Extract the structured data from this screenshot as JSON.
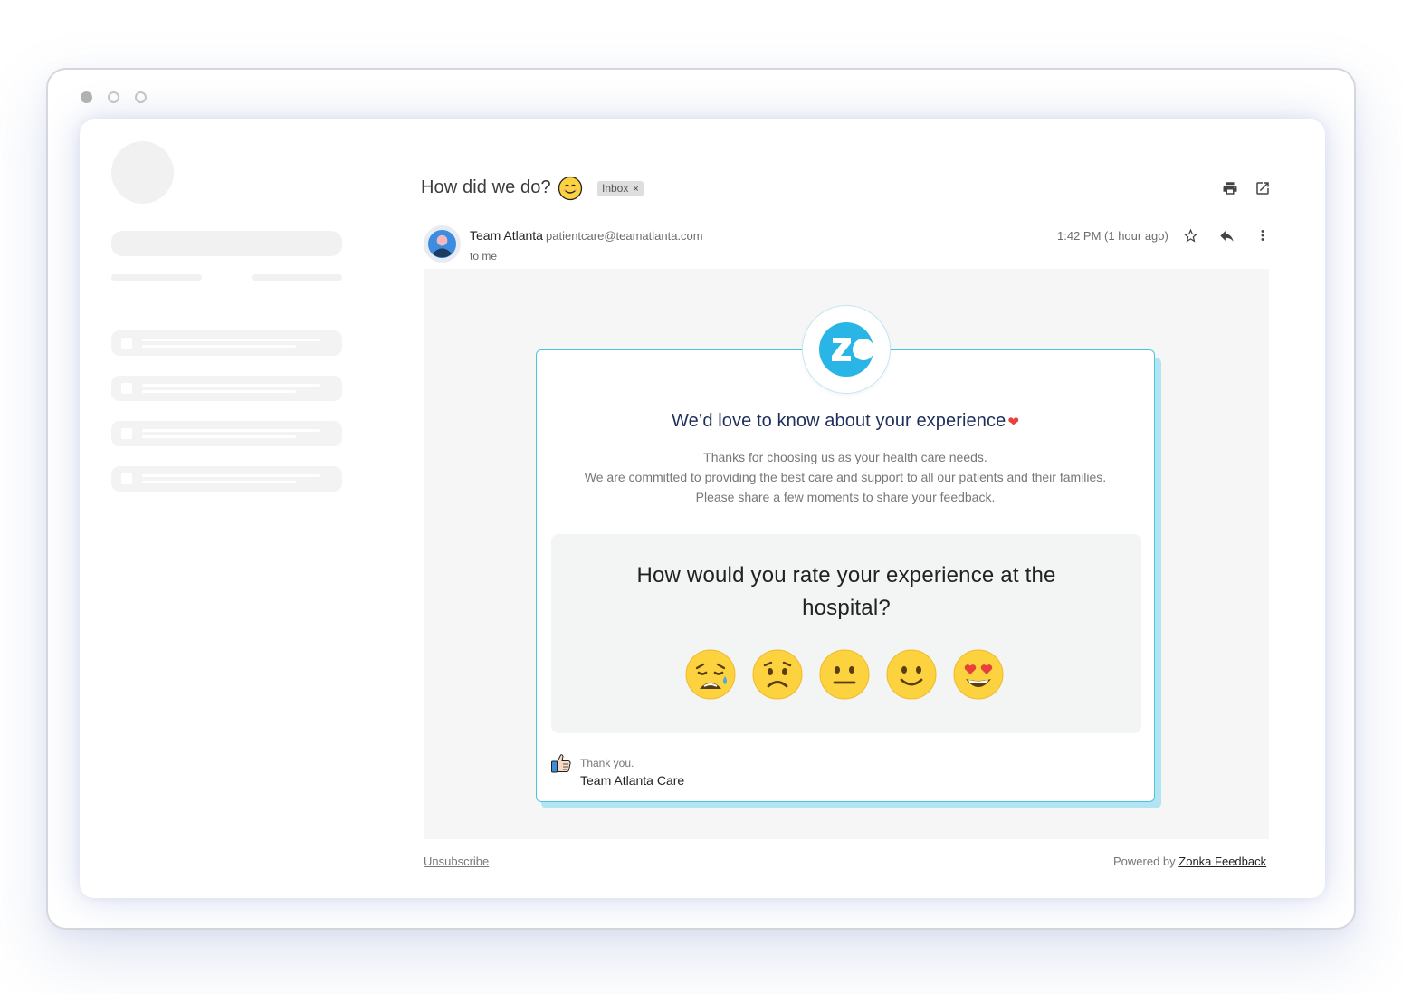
{
  "email": {
    "subject": "How did we do?",
    "label_chip": "Inbox",
    "label_remove": "×",
    "sender_name": "Team Atlanta",
    "sender_email": "patientcare@teamatlanta.com",
    "recipient": "to me",
    "time": "1:42 PM (1 hour ago)"
  },
  "icons": {
    "subject_emoji": "smiling-face-icon",
    "print": "print-icon",
    "open_new_window": "open-in-new-icon",
    "star": "star-icon",
    "reply": "reply-icon",
    "more": "more-vert-icon",
    "avatar": "person-avatar-icon",
    "logo": "zonka-logo-icon",
    "thumbs": "thumbs-up-icon"
  },
  "survey": {
    "title": "We’d love to know about your experience",
    "heart": "❤",
    "description": [
      "Thanks for choosing us as your health care needs.",
      "We are committed to providing the best care and support to all our patients and their families.",
      "Please share a few moments to share your feedback."
    ],
    "question_line1": "How would you rate your experience at the",
    "question_line2": "hospital?",
    "ratings": [
      "very-unhappy-face-icon",
      "unhappy-face-icon",
      "neutral-face-icon",
      "happy-face-icon",
      "love-face-icon"
    ],
    "thanks": "Thank you.",
    "signature": "Team Atlanta Care"
  },
  "footer": {
    "unsubscribe": "Unsubscribe",
    "powered_by": "Powered by",
    "brand": "Zonka Feedback"
  },
  "colors": {
    "accent": "#29b6e6",
    "title": "#1f2f5c",
    "heart": "#e8413a",
    "emoji": "#fcd33f"
  }
}
